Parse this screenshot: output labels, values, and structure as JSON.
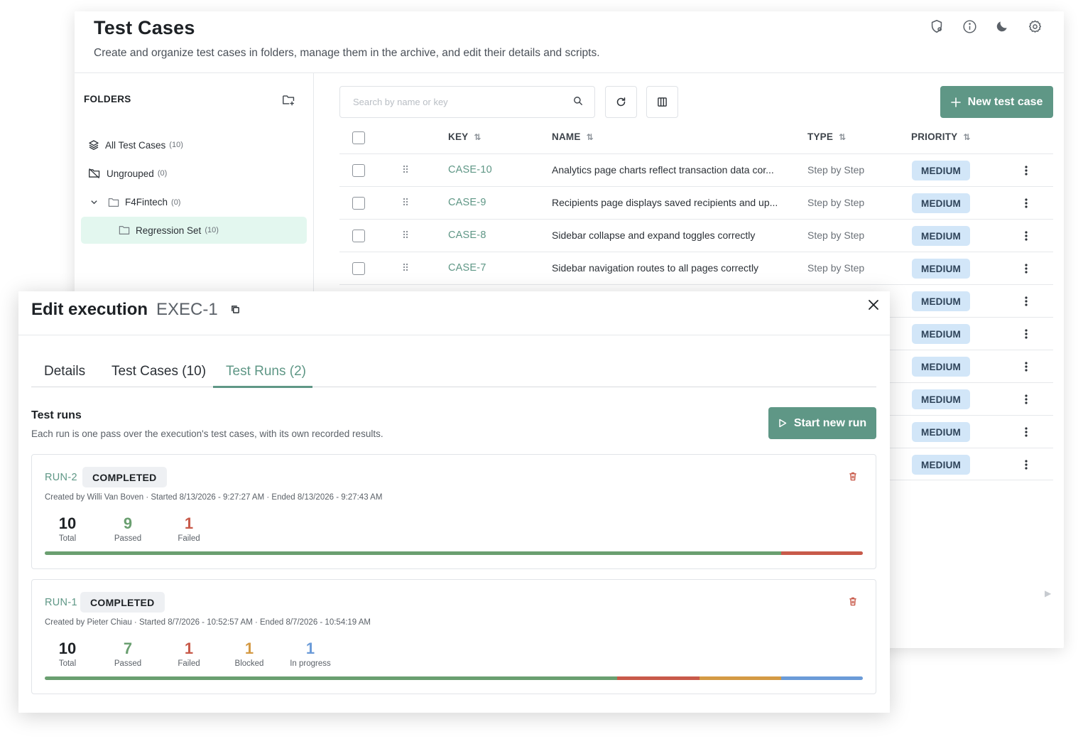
{
  "page": {
    "title": "Test Cases",
    "subtitle": "Create and organize test cases in folders, manage them in the archive, and edit their details and scripts."
  },
  "header_icons": [
    "shield-gear-icon",
    "info-icon",
    "moon-icon",
    "gear-icon"
  ],
  "colors": {
    "accent": "#5f9786",
    "passed": "#6a9f70",
    "failed": "#c85a4a",
    "blocked": "#d49a45",
    "in_progress": "#6b9bd8",
    "priority_badge": "#d2e6f8",
    "folder_selected": "#e3f7ef"
  },
  "folders": {
    "title": "FOLDERS",
    "items": [
      {
        "label": "All Test Cases",
        "count": "(10)",
        "icon": "layers-icon"
      },
      {
        "label": "Ungrouped",
        "count": "(0)",
        "icon": "folder-off-icon"
      },
      {
        "label": "F4Fintech",
        "count": "(0)",
        "icon": "folder-icon"
      },
      {
        "label": "Regression Set",
        "count": "(10)",
        "icon": "folder-icon",
        "selected": true
      }
    ]
  },
  "toolbar": {
    "search_placeholder": "Search by name or key",
    "new_button": "New test case"
  },
  "table": {
    "columns": [
      "KEY",
      "NAME",
      "TYPE",
      "PRIORITY"
    ],
    "rows": [
      {
        "key": "CASE-10",
        "name": "Analytics page charts reflect transaction data cor...",
        "type": "Step by Step",
        "priority": "MEDIUM"
      },
      {
        "key": "CASE-9",
        "name": "Recipients page displays saved recipients and up...",
        "type": "Step by Step",
        "priority": "MEDIUM"
      },
      {
        "key": "CASE-8",
        "name": "Sidebar collapse and expand toggles correctly",
        "type": "Step by Step",
        "priority": "MEDIUM"
      },
      {
        "key": "CASE-7",
        "name": "Sidebar navigation routes to all pages correctly",
        "type": "Step by Step",
        "priority": "MEDIUM"
      },
      {
        "key": "",
        "name": "",
        "type": "",
        "priority": "MEDIUM"
      },
      {
        "key": "",
        "name": "",
        "type": "",
        "priority": "MEDIUM"
      },
      {
        "key": "",
        "name": "",
        "type": "",
        "priority": "MEDIUM"
      },
      {
        "key": "",
        "name": "",
        "type": "",
        "priority": "MEDIUM"
      },
      {
        "key": "",
        "name": "",
        "type": "",
        "priority": "MEDIUM"
      },
      {
        "key": "",
        "name": "",
        "type": "",
        "priority": "MEDIUM"
      }
    ]
  },
  "modal": {
    "title": "Edit execution",
    "id": "EXEC-1",
    "tabs": [
      "Details",
      "Test Cases (10)",
      "Test Runs (2)"
    ],
    "active_tab": 2,
    "section_title": "Test runs",
    "section_subtitle": "Each run is one pass over the execution's test cases, with its own recorded results.",
    "start_button": "Start new run",
    "runs": [
      {
        "key": "RUN-2",
        "status": "COMPLETED",
        "meta": "Created by Willi Van Boven · Started 8/13/2026 - 9:27:27 AM · Ended 8/13/2026 - 9:27:43 AM",
        "stats": [
          {
            "value": "10",
            "label": "Total",
            "kind": "total"
          },
          {
            "value": "9",
            "label": "Passed",
            "kind": "passed"
          },
          {
            "value": "1",
            "label": "Failed",
            "kind": "failed"
          }
        ],
        "progress": [
          {
            "kind": "passed",
            "fraction": 0.9
          },
          {
            "kind": "failed",
            "fraction": 0.1
          }
        ]
      },
      {
        "key": "RUN-1",
        "status": "COMPLETED",
        "meta": "Created by Pieter Chiau · Started 8/7/2026 - 10:52:57 AM · Ended 8/7/2026 - 10:54:19 AM",
        "stats": [
          {
            "value": "10",
            "label": "Total",
            "kind": "total"
          },
          {
            "value": "7",
            "label": "Passed",
            "kind": "passed"
          },
          {
            "value": "1",
            "label": "Failed",
            "kind": "failed"
          },
          {
            "value": "1",
            "label": "Blocked",
            "kind": "blocked"
          },
          {
            "value": "1",
            "label": "In progress",
            "kind": "in_progress"
          }
        ],
        "progress": [
          {
            "kind": "passed",
            "fraction": 0.7
          },
          {
            "kind": "failed",
            "fraction": 0.1
          },
          {
            "kind": "blocked",
            "fraction": 0.1
          },
          {
            "kind": "in_progress",
            "fraction": 0.1
          }
        ]
      }
    ]
  }
}
